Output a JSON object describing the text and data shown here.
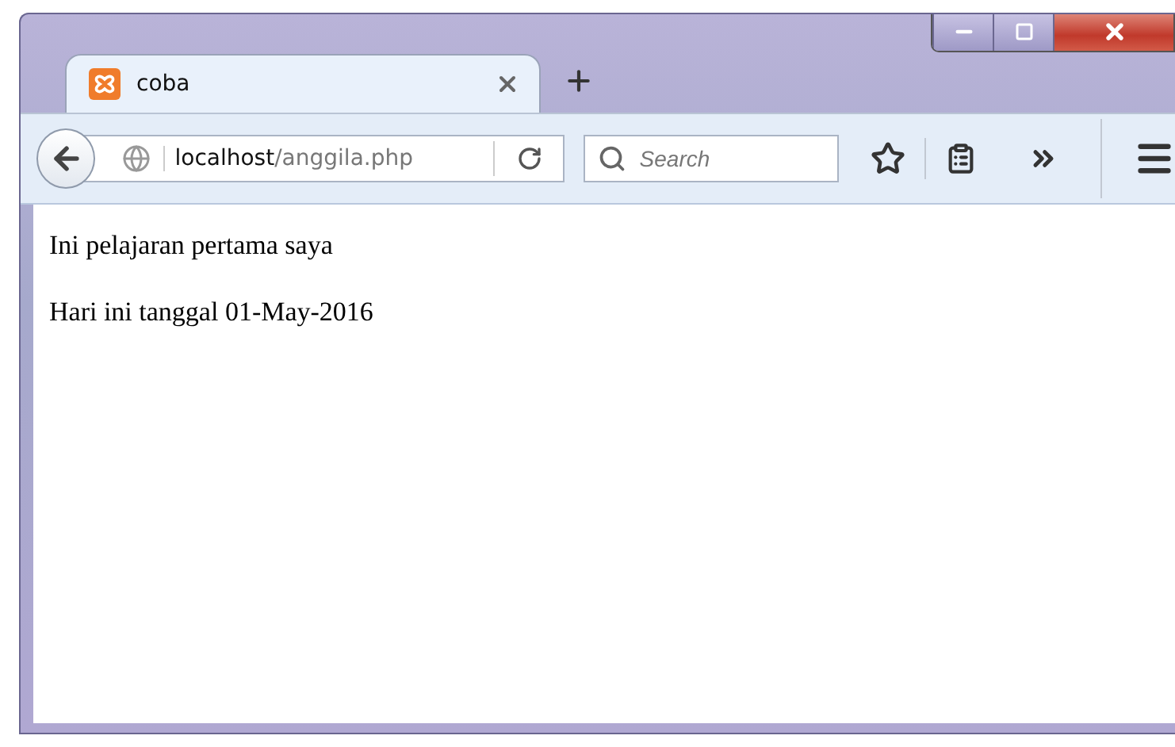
{
  "tabs": [
    {
      "title": "coba",
      "selected": true
    }
  ],
  "address": {
    "host": "localhost",
    "path": "/anggila.php"
  },
  "search": {
    "placeholder": "Search"
  },
  "page": {
    "paragraphs": [
      "Ini pelajaran pertama saya",
      "Hari ini tanggal 01-May-2016"
    ]
  }
}
